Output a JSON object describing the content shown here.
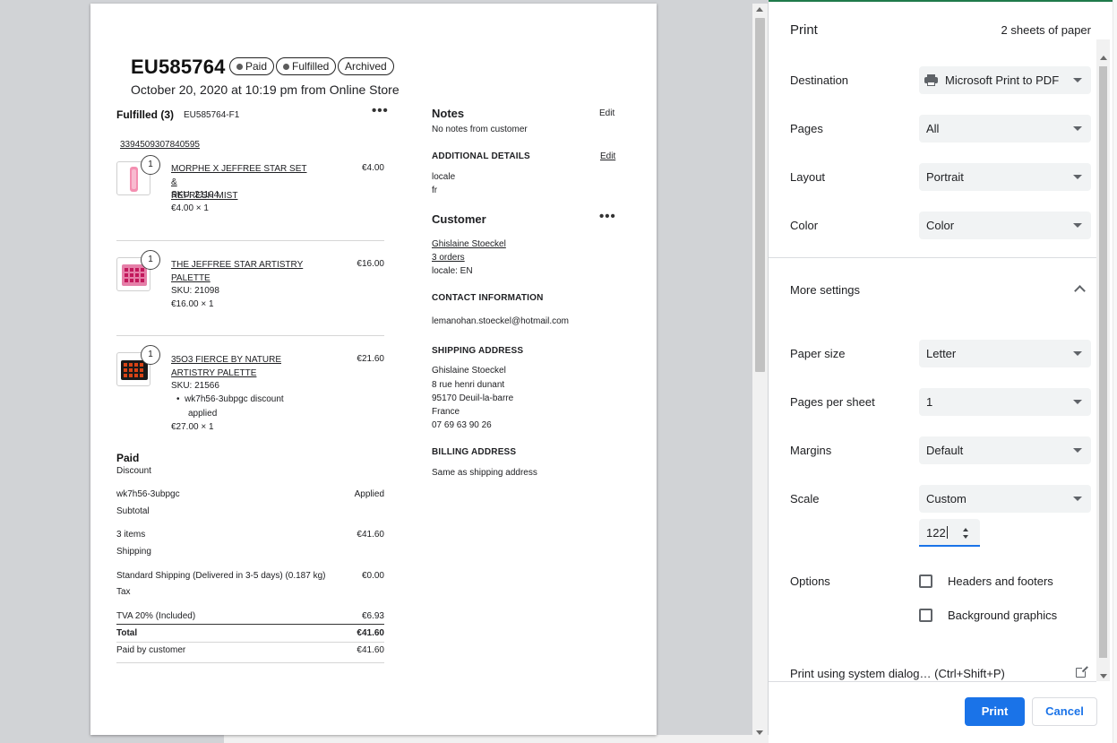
{
  "order": {
    "title": "EU585764",
    "badges": [
      "Paid",
      "Fulfilled",
      "Archived"
    ],
    "date_line": "October 20, 2020 at 10:19 pm from Online Store"
  },
  "fulfilled": {
    "heading": "Fulfilled (3)",
    "fulfillment_id": "EU585764-F1",
    "tracking": "3394509307840595",
    "items": [
      {
        "qty": "1",
        "name_line1": "MORPHE X JEFFREE STAR SET &",
        "name_line2": "REFRESH MIST",
        "sku": "SKU: 21104",
        "unit": "€4.00 × 1",
        "price": "€4.00"
      },
      {
        "qty": "1",
        "name_line1": "THE JEFFREE STAR ARTISTRY",
        "name_line2": "PALETTE",
        "sku": "SKU: 21098",
        "unit": "€16.00 × 1",
        "price": "€16.00"
      },
      {
        "qty": "1",
        "name_line1": "35O3 FIERCE BY NATURE",
        "name_line2": "ARTISTRY PALETTE",
        "sku": "SKU: 21566",
        "discount_line1": "wk7h56-3ubpgc discount",
        "discount_line2": "applied",
        "unit": "€27.00 × 1",
        "price": "€21.60"
      }
    ]
  },
  "payment": {
    "heading": "Paid",
    "rows": [
      {
        "label": "Discount",
        "left": "",
        "right": ""
      },
      {
        "label": "wk7h56-3ubpgc",
        "right": "Applied"
      },
      {
        "label": "Subtotal"
      },
      {
        "label": "3 items",
        "right": "€41.60"
      },
      {
        "label": "Shipping"
      },
      {
        "label": "Standard Shipping (Delivered in 3-5 days) (0.187 kg)",
        "right": "€0.00"
      },
      {
        "label": "Tax"
      },
      {
        "label": "TVA 20% (Included)",
        "right": "€6.93"
      },
      {
        "label": "Total",
        "right": "€41.60"
      },
      {
        "label": "Paid by customer",
        "right": "€41.60"
      }
    ]
  },
  "notes": {
    "heading": "Notes",
    "edit": "Edit",
    "text": "No notes from customer",
    "additional_heading": "ADDITIONAL DETAILS",
    "additional_edit": "Edit",
    "additional_key": "locale",
    "additional_value": "fr"
  },
  "customer": {
    "heading": "Customer",
    "name": "Ghislaine Stoeckel",
    "orders": "3 orders",
    "locale": "locale: EN",
    "contact_heading": "CONTACT INFORMATION",
    "email": "lemanohan.stoeckel@hotmail.com",
    "shipping_heading": "SHIPPING ADDRESS",
    "shipping_lines": [
      "Ghislaine Stoeckel",
      "8 rue henri dunant",
      "95170 Deuil-la-barre",
      "France",
      "07 69 63 90 26"
    ],
    "billing_heading": "BILLING ADDRESS",
    "billing_text": "Same as shipping address"
  },
  "print_panel": {
    "title": "Print",
    "sheets": "2 sheets of paper",
    "destination_label": "Destination",
    "destination_value": "Microsoft Print to PDF",
    "pages_label": "Pages",
    "pages_value": "All",
    "layout_label": "Layout",
    "layout_value": "Portrait",
    "color_label": "Color",
    "color_value": "Color",
    "more_settings": "More settings",
    "paper_size_label": "Paper size",
    "paper_size_value": "Letter",
    "pps_label": "Pages per sheet",
    "pps_value": "1",
    "margins_label": "Margins",
    "margins_value": "Default",
    "scale_label": "Scale",
    "scale_value": "Custom",
    "scale_input": "122",
    "options_label": "Options",
    "option_headers": "Headers and footers",
    "option_background": "Background graphics",
    "system_dialog": "Print using system dialog… (Ctrl+Shift+P)",
    "print_button": "Print",
    "cancel_button": "Cancel"
  }
}
